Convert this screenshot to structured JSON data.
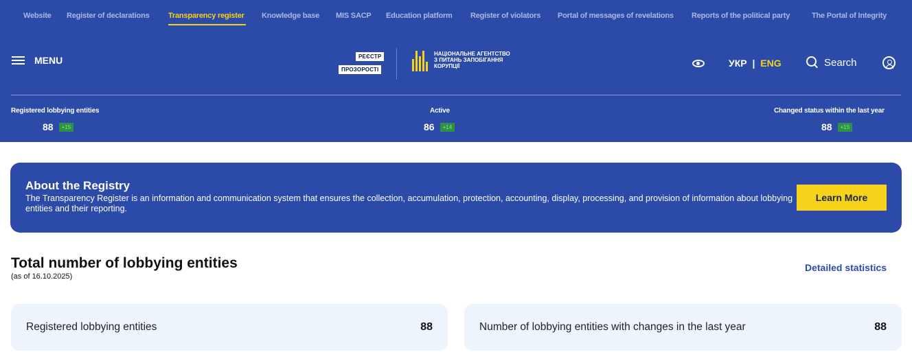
{
  "top_nav": [
    {
      "label": "Website",
      "active": false
    },
    {
      "label": "Register of declarations",
      "active": false
    },
    {
      "label": "Transparency register",
      "active": true
    },
    {
      "label": "Knowledge base",
      "active": false
    },
    {
      "label": "MIS SACP",
      "active": false
    },
    {
      "label": "Education platform",
      "active": false
    },
    {
      "label": "Register of violators",
      "active": false
    },
    {
      "label": "Portal of messages of revelations",
      "active": false
    },
    {
      "label": "Reports of the political party",
      "active": false
    },
    {
      "label": "The Portal of Integrity",
      "active": false
    }
  ],
  "header": {
    "menu_label": "MENU",
    "logo_top": "РЕЄСТР",
    "logo_bottom": "ПРОЗОРОСТІ",
    "agency_line1": "НАЦІОНАЛЬНЕ АГЕНТСТВО",
    "agency_line2": "З ПИТАНЬ ЗАПОБІГАННЯ",
    "agency_line3": "КОРУПЦІЇ",
    "lang_ukr": "УКР",
    "lang_sep": "|",
    "lang_eng": "ENG",
    "search_label": "Search"
  },
  "stats": [
    {
      "label": "Registered lobbying entities",
      "value": "88",
      "delta": "+15"
    },
    {
      "label": "Active",
      "value": "86",
      "delta": "+14"
    },
    {
      "label": "Changed status within the last year",
      "value": "88",
      "delta": "+15"
    }
  ],
  "about": {
    "title": "About the Registry",
    "text": "The Transparency Register is an information and communication system that ensures the collection, accumulation, protection, accounting, display, processing, and provision of information about lobbying entities and their reporting.",
    "button": "Learn More"
  },
  "totals": {
    "title": "Total number of lobbying entities",
    "subtitle": "(as of 16.10.2025)",
    "detailed_link": "Detailed statistics",
    "cards": [
      {
        "label": "Registered lobbying entities",
        "value": "88"
      },
      {
        "label": "Number of lobbying entities with changes in the last year",
        "value": "88"
      }
    ]
  },
  "colors": {
    "primary": "#2c4aa8",
    "accent": "#f6d21b",
    "card_bg": "#eef4fb",
    "delta_bg": "#2e9144"
  }
}
